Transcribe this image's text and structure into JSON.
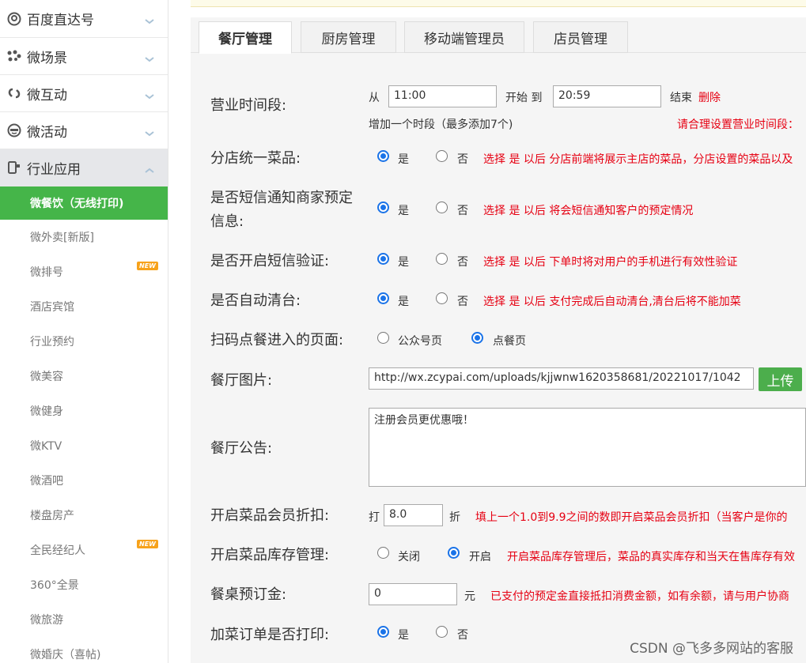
{
  "sidebar": {
    "menu": [
      {
        "label": "百度直达号",
        "icon": "target-icon"
      },
      {
        "label": "微场景",
        "icon": "dots-icon"
      },
      {
        "label": "微互动",
        "icon": "link-icon"
      },
      {
        "label": "微活动",
        "icon": "face-icon"
      },
      {
        "label": "行业应用",
        "icon": "phone-icon"
      }
    ],
    "submenu": [
      {
        "label": "微餐饮（无线打印)",
        "selected": true,
        "new": false
      },
      {
        "label": "微外卖[新版]",
        "new": false
      },
      {
        "label": "微排号",
        "new": true
      },
      {
        "label": "酒店宾馆",
        "new": false
      },
      {
        "label": "行业预约",
        "new": false
      },
      {
        "label": "微美容",
        "new": false
      },
      {
        "label": "微健身",
        "new": false
      },
      {
        "label": "微KTV",
        "new": false
      },
      {
        "label": "微酒吧",
        "new": false
      },
      {
        "label": "楼盘房产",
        "new": false
      },
      {
        "label": "全民经纪人",
        "new": true
      },
      {
        "label": "360°全景",
        "new": false
      },
      {
        "label": "微旅游",
        "new": false
      },
      {
        "label": "微婚庆（喜帖)",
        "new": false
      }
    ],
    "new_badge": "NEW"
  },
  "tabs": [
    "餐厅管理",
    "厨房管理",
    "移动端管理员",
    "店员管理"
  ],
  "form": {
    "hours": {
      "label": "营业时间段:",
      "from": "从",
      "start_value": "11:00",
      "start_to": "开始 到",
      "end_value": "20:59",
      "end": "结束",
      "delete": "删除",
      "add": "增加一个时段（最多添加7个)",
      "hint": "请合理设置营业时间段："
    },
    "unified_menu": {
      "label": "分店统一菜品:",
      "yes": "是",
      "no": "否",
      "hint": "选择 是 以后 分店前端将展示主店的菜品，分店设置的菜品以及"
    },
    "sms_notify": {
      "label_line1": "是否短信通知商家预定",
      "label_line2": "信息:",
      "yes": "是",
      "no": "否",
      "hint": "选择 是 以后 将会短信通知客户的预定情况"
    },
    "sms_verify": {
      "label": "是否开启短信验证:",
      "yes": "是",
      "no": "否",
      "hint": "选择 是 以后 下单时将对用户的手机进行有效性验证"
    },
    "auto_clear": {
      "label": "是否自动清台:",
      "yes": "是",
      "no": "否",
      "hint": "选择 是 以后 支付完成后自动清台,清台后将不能加菜"
    },
    "scan_page": {
      "label": "扫码点餐进入的页面:",
      "opt1": "公众号页",
      "opt2": "点餐页"
    },
    "image": {
      "label": "餐厅图片:",
      "value": "http://wx.zcypai.com/uploads/kjjwnw1620358681/20221017/1042",
      "button": "上传"
    },
    "notice": {
      "label": "餐厅公告:",
      "value": "注册会员更优惠哦！"
    },
    "discount": {
      "label": "开启菜品会员折扣:",
      "prefix": "打",
      "value": "8.0",
      "suffix": "折",
      "hint": "填上一个1.0到9.9之间的数即开启菜品会员折扣（当客户是你的"
    },
    "stock": {
      "label": "开启菜品库存管理:",
      "off": "关闭",
      "on": "开启",
      "hint": "开启菜品库存管理后，菜品的真实库存和当天在售库存有效"
    },
    "deposit": {
      "label": "餐桌预订金:",
      "value": "0",
      "unit": "元",
      "hint": "已支付的预定金直接抵扣消费金额，如有余额，请与用户协商"
    },
    "print_add": {
      "label": "加菜订单是否打印:",
      "yes": "是",
      "no": "否"
    }
  },
  "watermark": "CSDN @飞多多网站的客服",
  "colors": {
    "accent_green": "#45b549",
    "radio_blue": "#1a73e8",
    "hint_red": "#e60012"
  }
}
